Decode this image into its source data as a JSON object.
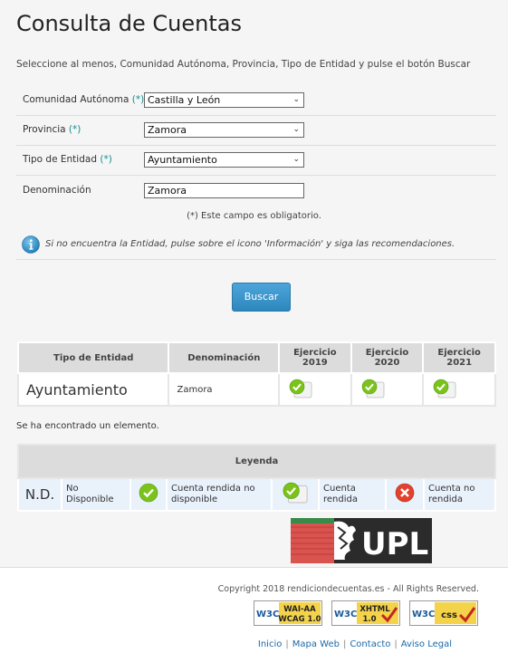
{
  "page": {
    "title": "Consulta de Cuentas",
    "subtitle": "Seleccione al menos, Comunidad Autónoma, Provincia, Tipo de Entidad y pulse el botón Buscar"
  },
  "form": {
    "comunidad": {
      "label": "Comunidad Autónoma",
      "req": "(*)",
      "value": "Castilla y León"
    },
    "provincia": {
      "label": "Provincia",
      "req": "(*)",
      "value": "Zamora"
    },
    "tipo": {
      "label": "Tipo de Entidad",
      "req": "(*)",
      "value": "Ayuntamiento"
    },
    "denominacion": {
      "label": "Denominación",
      "value": "Zamora"
    },
    "obligatorio": "(*) Este campo es obligatorio.",
    "info_text": "Si no encuentra la Entidad, pulse sobre el icono 'Información' y siga las recomendaciones.",
    "buscar_label": "Buscar"
  },
  "results": {
    "headers": {
      "tipo": "Tipo de Entidad",
      "denominacion": "Denominación",
      "ej_label": "Ejercicio",
      "years": [
        "2019",
        "2020",
        "2021"
      ]
    },
    "rows": [
      {
        "tipo": "Ayuntamiento",
        "denominacion": "Zamora"
      }
    ],
    "found_text": "Se ha encontrado un elemento."
  },
  "legend": {
    "title": "Leyenda",
    "nd": "N.D.",
    "no_disponible": "No Disponible",
    "cuenta_rendida_no_disp": "Cuenta rendida no disponible",
    "cuenta_rendida": "Cuenta rendida",
    "cuenta_no_rendida": "Cuenta no rendida"
  },
  "logo": {
    "text": "UPL"
  },
  "footer": {
    "copyright": "Copyright 2018 rendiciondecuentas.es - All Rights Reserved.",
    "badges": {
      "wai_top": "WAI-AA",
      "wai_bottom": "WCAG 1.0",
      "xhtml_top": "XHTML",
      "xhtml_bottom": "1.0",
      "css": "css",
      "w3c": "W3C"
    },
    "links": [
      "Inicio",
      "Mapa Web",
      "Contacto",
      "Aviso Legal"
    ]
  },
  "colors": {
    "accent": "#1a8c8c",
    "button": "#2d86bd",
    "check_green": "#7bc21b",
    "cross_red": "#e2412d",
    "link": "#1a6aa8"
  }
}
